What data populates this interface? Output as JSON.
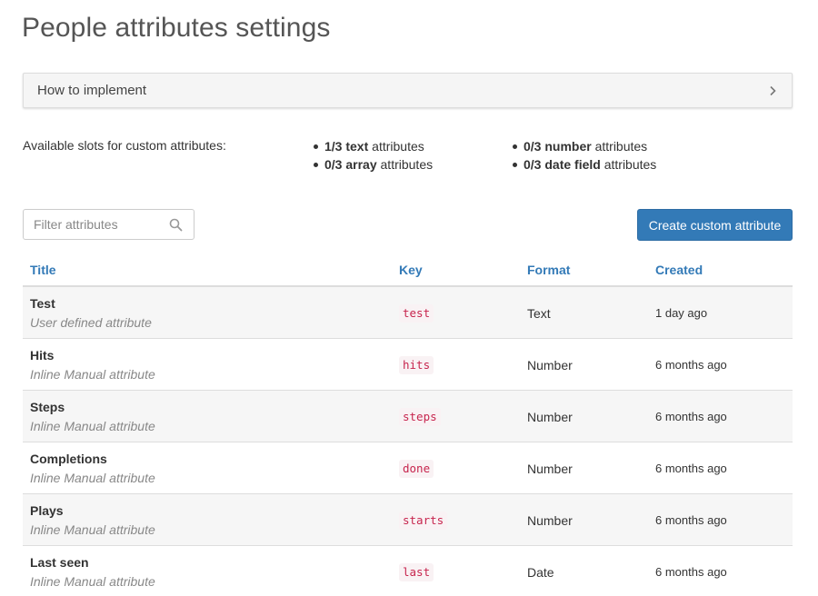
{
  "page": {
    "title": "People attributes settings"
  },
  "accordion": {
    "label": "How to implement",
    "icon": "chevron-right-icon"
  },
  "slots": {
    "label": "Available slots for custom attributes:",
    "items": [
      {
        "count": "1/3",
        "type": "text",
        "suffix": " attributes"
      },
      {
        "count": "0/3",
        "type": "array",
        "suffix": " attributes"
      },
      {
        "count": "0/3",
        "type": "number",
        "suffix": " attributes"
      },
      {
        "count": "0/3",
        "type": "date field",
        "suffix": " attributes"
      }
    ]
  },
  "filter": {
    "placeholder": "Filter attributes",
    "value": "",
    "icon": "search-icon"
  },
  "create_button": {
    "label": "Create custom attribute",
    "color": "#337ab7"
  },
  "table": {
    "headers": {
      "title": "Title",
      "key": "Key",
      "format": "Format",
      "created": "Created"
    },
    "header_color": "#337ab7",
    "rows": [
      {
        "title": "Test",
        "subtitle": "User defined attribute",
        "key": "test",
        "format": "Text",
        "created": "1 day ago"
      },
      {
        "title": "Hits",
        "subtitle": "Inline Manual attribute",
        "key": "hits",
        "format": "Number",
        "created": "6 months ago"
      },
      {
        "title": "Steps",
        "subtitle": "Inline Manual attribute",
        "key": "steps",
        "format": "Number",
        "created": "6 months ago"
      },
      {
        "title": "Completions",
        "subtitle": "Inline Manual attribute",
        "key": "done",
        "format": "Number",
        "created": "6 months ago"
      },
      {
        "title": "Plays",
        "subtitle": "Inline Manual attribute",
        "key": "starts",
        "format": "Number",
        "created": "6 months ago"
      },
      {
        "title": "Last seen",
        "subtitle": "Inline Manual attribute",
        "key": "last",
        "format": "Date",
        "created": "6 months ago"
      }
    ]
  }
}
